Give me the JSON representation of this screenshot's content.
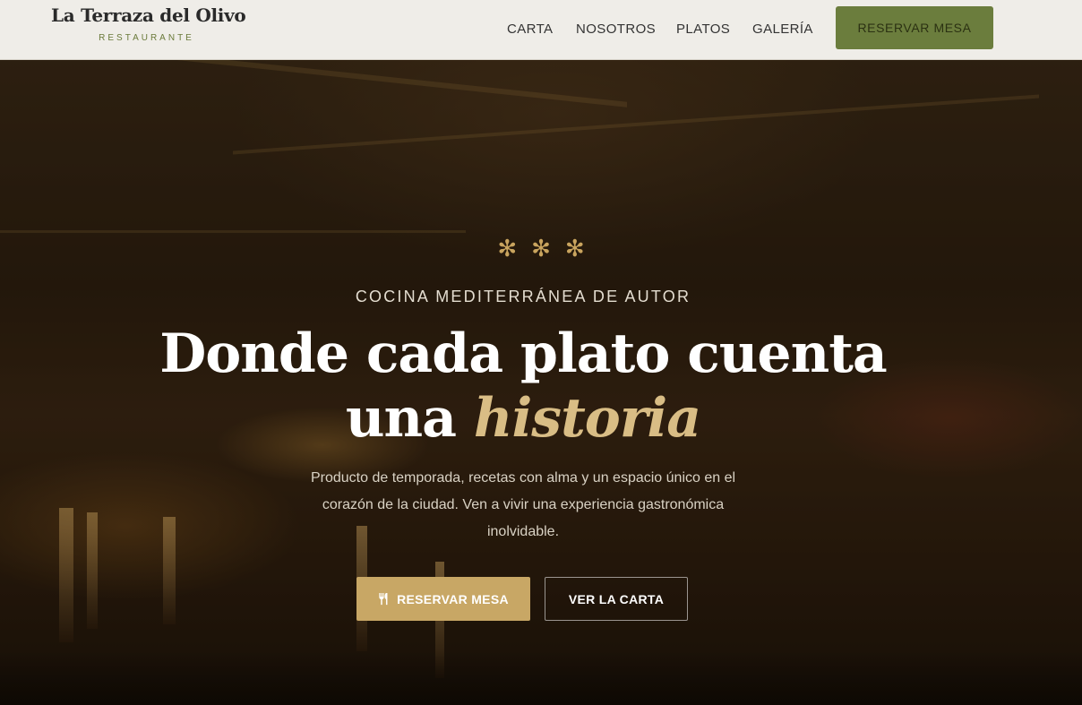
{
  "header": {
    "brand_name": "La Terraza del Olivo",
    "brand_sub": "RESTAURANTE",
    "nav": [
      "CARTA",
      "NOSOTROS",
      "PLATOS",
      "GALERÍA"
    ],
    "cta_label": "RESERVAR MESA"
  },
  "hero": {
    "ornament": "✻✻✻",
    "eyebrow": "COCINA MEDITERRÁNEA DE AUTOR",
    "title_line1": "Donde cada plato cuenta",
    "title_line2_prefix": "una",
    "title_line2_accent": "historia",
    "lead": "Producto de temporada, recetas con alma y un espacio único en el corazón de la ciudad. Ven a vivir una experiencia gastronómica inolvidable.",
    "primary_button": "RESERVAR MESA",
    "primary_icon": "utensils-icon",
    "secondary_button": "VER LA CARTA"
  },
  "colors": {
    "header_bg": "#efede8",
    "brand_accent": "#6b7d3d",
    "gold": "#c8a765",
    "accent_text": "#d9bd85"
  }
}
